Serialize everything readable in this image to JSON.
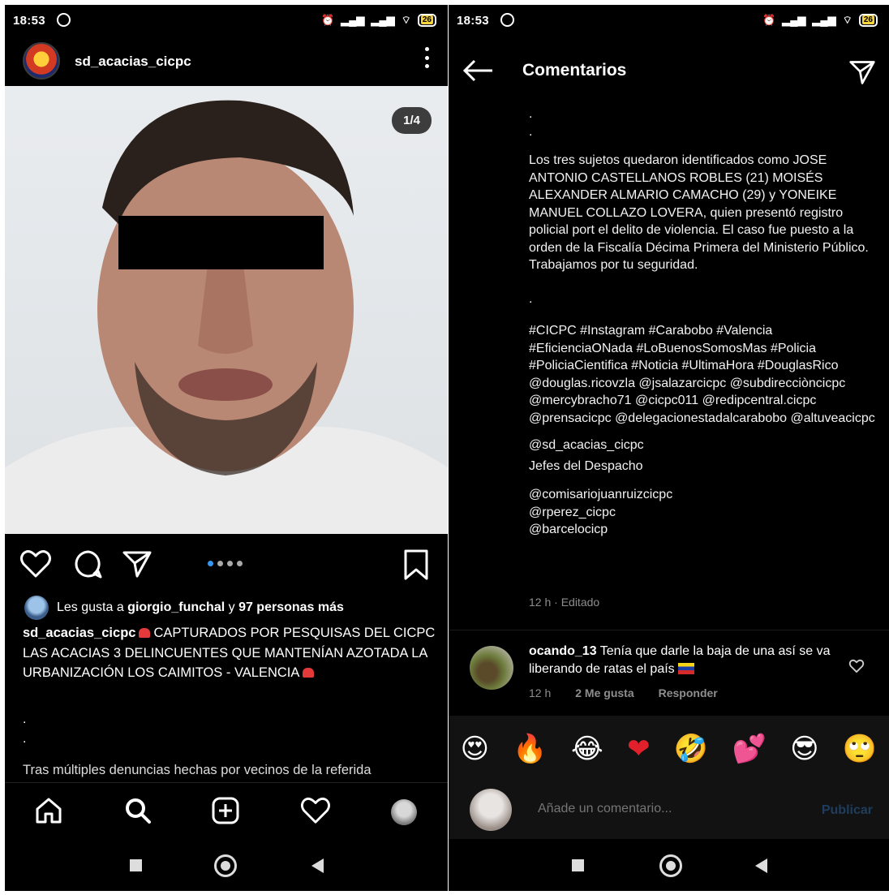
{
  "status_left": {
    "time": "18:53",
    "battery": "26"
  },
  "status_right": {
    "time": "18:53",
    "battery": "26"
  },
  "post": {
    "username": "sd_acacias_cicpc",
    "counter": "1/4",
    "likes_prefix": "Les gusta a ",
    "likes_user": "giorgio_funchal",
    "likes_suffix": " y ",
    "likes_count": "97 personas más",
    "caption_user": "sd_acacias_cicpc",
    "caption_text": "CAPTURADOS POR PESQUISAS DEL CICPC LAS ACACIAS 3 DELINCUENTES QUE MANTENÍAN AZOTADA LA URBANIZACIÓN LOS CAIMITOS - VALENCIA",
    "caption_dot": ".",
    "caption_more": "Tras múltiples denuncias hechas por vecinos de la referida"
  },
  "comments": {
    "title": "Comentarios",
    "dot": ".",
    "body_text": "Los tres sujetos quedaron identificados como JOSE ANTONIO CASTELLANOS ROBLES (21) MOISÉS ALEXANDER ALMARIO CAMACHO (29) y YONEIKE MANUEL COLLAZO LOVERA, quien presentó registro policial port el delito de violencia. El caso fue puesto a la orden de la Fiscalía Décima Primera del Ministerio Público. Trabajamos por tu seguridad.",
    "hashtags": "#CICPC #Instagram #Carabobo #Valencia #EficienciaONada #LoBuenosSomosMas #Policia #PoliciaCientifica #Noticia #UltimaHora #DouglasRico @douglas.ricovzla @jsalazarcicpc @subdirecciòncicpc @mercybracho71 @cicpc011 @redipcentral.cicpc @prensacicpc @delegacionestadalcarabobo @altuveacicpc",
    "mention": "@sd_acacias_cicpc",
    "jefes": "Jefes del Despacho",
    "comisarios": "@comisariojuanruizcicpc\n@rperez_cicpc\n@barcelocicp",
    "edited": "12 h · Editado",
    "comment": {
      "user": "ocando_13",
      "text": "Tenía que darle la baja de una así se va liberando de ratas el país",
      "time": "12 h",
      "likes": "2 Me gusta",
      "reply": "Responder"
    },
    "emojis": [
      "😍",
      "🔥",
      "😂",
      "❤",
      "🤣",
      "💕",
      "😎",
      "🙄"
    ],
    "add_placeholder": "Añade un comentario...",
    "publish": "Publicar"
  }
}
